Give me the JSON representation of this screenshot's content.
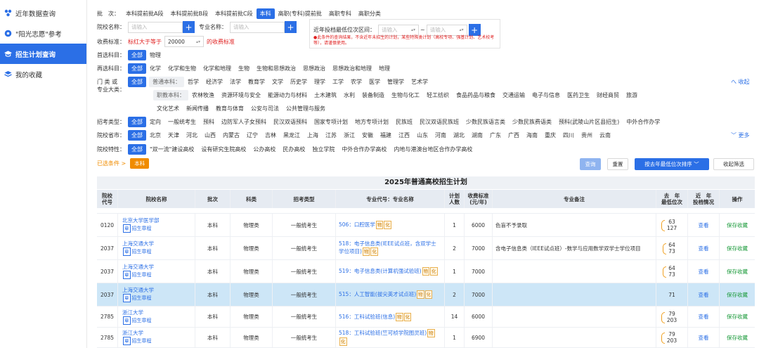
{
  "sidebar": {
    "items": [
      {
        "label": "近年数据查询",
        "icon": "data-icon"
      },
      {
        "label": "\"阳光志愿\"参考",
        "icon": "sun-icon"
      },
      {
        "label": "招生计划查询",
        "icon": "hat-icon",
        "active": true
      },
      {
        "label": "我的收藏",
        "icon": "stack-icon"
      }
    ]
  },
  "filters": {
    "batch": {
      "label": "批　次：",
      "options": [
        "本科提前批A段",
        "本科提前批B段",
        "本科提前批C段",
        "本科",
        "高职(专科)提前批",
        "高职专科",
        "高职分类"
      ],
      "selected": "本科"
    },
    "school_name": {
      "label": "院校名称：",
      "placeholder": "请输入"
    },
    "major_name": {
      "label": "专业名称：",
      "placeholder": "请输入"
    },
    "rank_range": {
      "label": "近年投档最低位次区间：",
      "placeholder_from": "请输入",
      "placeholder_to": "请输入",
      "sep": "~",
      "note": "●此条件的查询结果，不含近年未招生的计划，某些特殊类计划（高校专项、强基计划、艺术校考等），请谨慎使用。"
    },
    "fee": {
      "label": "收费标准：",
      "prefix": "标红大于等于",
      "value": "20000",
      "suffix": "的收费标准"
    },
    "first_subject": {
      "label": "首选科目：",
      "options": [
        "全部",
        "物理"
      ]
    },
    "second_subject": {
      "label": "再选科目：",
      "options": [
        "全部",
        "化学",
        "化学和生物",
        "化学和地理",
        "生物",
        "生物和思想政治",
        "思想政治",
        "思想政治和地理",
        "地理"
      ]
    },
    "category": {
      "label": "门 类 或\n专业大类：",
      "undergrad_label": "普通本科：",
      "undergrad": [
        "哲学",
        "经济学",
        "法学",
        "教育学",
        "文学",
        "历史学",
        "理学",
        "工学",
        "农学",
        "医学",
        "管理学",
        "艺术学"
      ],
      "vocational_label": "职教本科：",
      "vocational": [
        "农林牧渔",
        "资源环境与安全",
        "能源动力与材料",
        "土木建筑",
        "水利",
        "装备制造",
        "生物与化工",
        "轻工纺织",
        "食品药品与粮食",
        "交通运输",
        "电子与信息",
        "医药卫生",
        "财经商贸",
        "旅游"
      ],
      "vocational2": [
        "文化艺术",
        "新闻传播",
        "教育与体育",
        "公安与司法",
        "公共管理与服务"
      ],
      "all": "全部",
      "collapse": "へ 收起"
    },
    "enroll_type": {
      "label": "招考类型：",
      "options": [
        "全部",
        "定向",
        "一般统考生",
        "预科",
        "边防军人子女预科",
        "民汉双语预科",
        "国家专项计划",
        "地方专项计划",
        "民族班",
        "民汉双语民族班",
        "少数民族语言类",
        "少数民族费语类",
        "预科(武陵山片区县招生)",
        "中外合作办学"
      ]
    },
    "city": {
      "label": "院校省市：",
      "options": [
        "全部",
        "北京",
        "天津",
        "河北",
        "山西",
        "内蒙古",
        "辽宁",
        "吉林",
        "黑龙江",
        "上海",
        "江苏",
        "浙江",
        "安徽",
        "福建",
        "江西",
        "山东",
        "河南",
        "湖北",
        "湖南",
        "广东",
        "广西",
        "海南",
        "重庆",
        "四川",
        "贵州",
        "云南"
      ],
      "more": "﹀ 更多"
    },
    "feature": {
      "label": "院校特性：",
      "options": [
        "全部",
        "\"双一流\"建设高校",
        "设有研究生院高校",
        "公办高校",
        "民办高校",
        "独立学院",
        "中外合作办学高校",
        "内地与港澳台地区合作办学高校"
      ]
    },
    "chosen": {
      "label": "已选条件 >",
      "tag": "本科"
    }
  },
  "actions": {
    "query": "查询",
    "reset": "重置",
    "sort": "按去年最低位次排序 ﹀",
    "fold": "收起筛选"
  },
  "table": {
    "title": "2025年普通高校招生计划",
    "headers": [
      "院校\n代号",
      "院校名称",
      "批次",
      "科类",
      "招考类型",
      "专业代号：专业名称",
      "计划\n人数",
      "收费标准\n(元/年)",
      "专业备注",
      "去　年\n最低位次",
      "近　年\n投档情况",
      "操作"
    ],
    "rows": [
      {
        "code": "0120",
        "name": "北京大学医学部",
        "charter": "招生章程",
        "batch": "本科",
        "type": "物理类",
        "enroll": "一般统考生",
        "major": "506：口腔医学",
        "tags": [
          "物",
          "化"
        ],
        "plan": "1",
        "fee": "6000",
        "note": "色盲不予录取",
        "rank_a": "63",
        "rank_b": "127",
        "view": "查看",
        "save": "保存收藏"
      },
      {
        "code": "2037",
        "name": "上海交通大学",
        "charter": "招生章程",
        "batch": "本科",
        "type": "物理类",
        "enroll": "一般统考生",
        "major": "518：电子信息类(IEEE试点班，含双学士学位项目)",
        "tags": [
          "物",
          "化"
        ],
        "plan": "2",
        "fee": "7000",
        "note": "含电子信息类（IEEE试点班）-数学与应用数学双学士学位项目",
        "rank_a": "64",
        "rank_b": "73",
        "view": "查看",
        "save": "保存收藏"
      },
      {
        "code": "2037",
        "name": "上海交通大学",
        "charter": "招生章程",
        "batch": "本科",
        "type": "物理类",
        "enroll": "一般统考生",
        "major": "519：电子信息类(计算机强试验班)",
        "tags": [
          "物",
          "化"
        ],
        "plan": "1",
        "fee": "7000",
        "note": "",
        "rank_a": "64",
        "rank_b": "73",
        "view": "查看",
        "save": "保存收藏"
      },
      {
        "code": "2037",
        "name": "上海交通大学",
        "charter": "招生章程",
        "batch": "本科",
        "type": "物理类",
        "enroll": "一般统考生",
        "major": "515：人工智能(拔尖英才试点班)",
        "tags": [
          "物",
          "化"
        ],
        "plan": "2",
        "fee": "7000",
        "note": "",
        "rank_a": "71",
        "rank_b": "",
        "view": "查看",
        "save": "保存收藏",
        "highlight": true
      },
      {
        "code": "2785",
        "name": "浙江大学",
        "charter": "招生章程",
        "batch": "本科",
        "type": "物理类",
        "enroll": "一般统考生",
        "major": "516：工科试验班(信息)",
        "tags": [
          "物",
          "化"
        ],
        "plan": "14",
        "fee": "6000",
        "note": "",
        "rank_a": "79",
        "rank_b": "203",
        "view": "查看",
        "save": "保存收藏"
      },
      {
        "code": "2785",
        "name": "浙江大学",
        "charter": "招生章程",
        "batch": "本科",
        "type": "物理类",
        "enroll": "一般统考生",
        "major": "518：工科试验班(竺可桢学院图灵班)",
        "tags": [
          "物",
          "化"
        ],
        "plan": "1",
        "fee": "6900",
        "note": "",
        "rank_a": "79",
        "rank_b": "203",
        "view": "查看",
        "save": "保存收藏"
      }
    ]
  }
}
